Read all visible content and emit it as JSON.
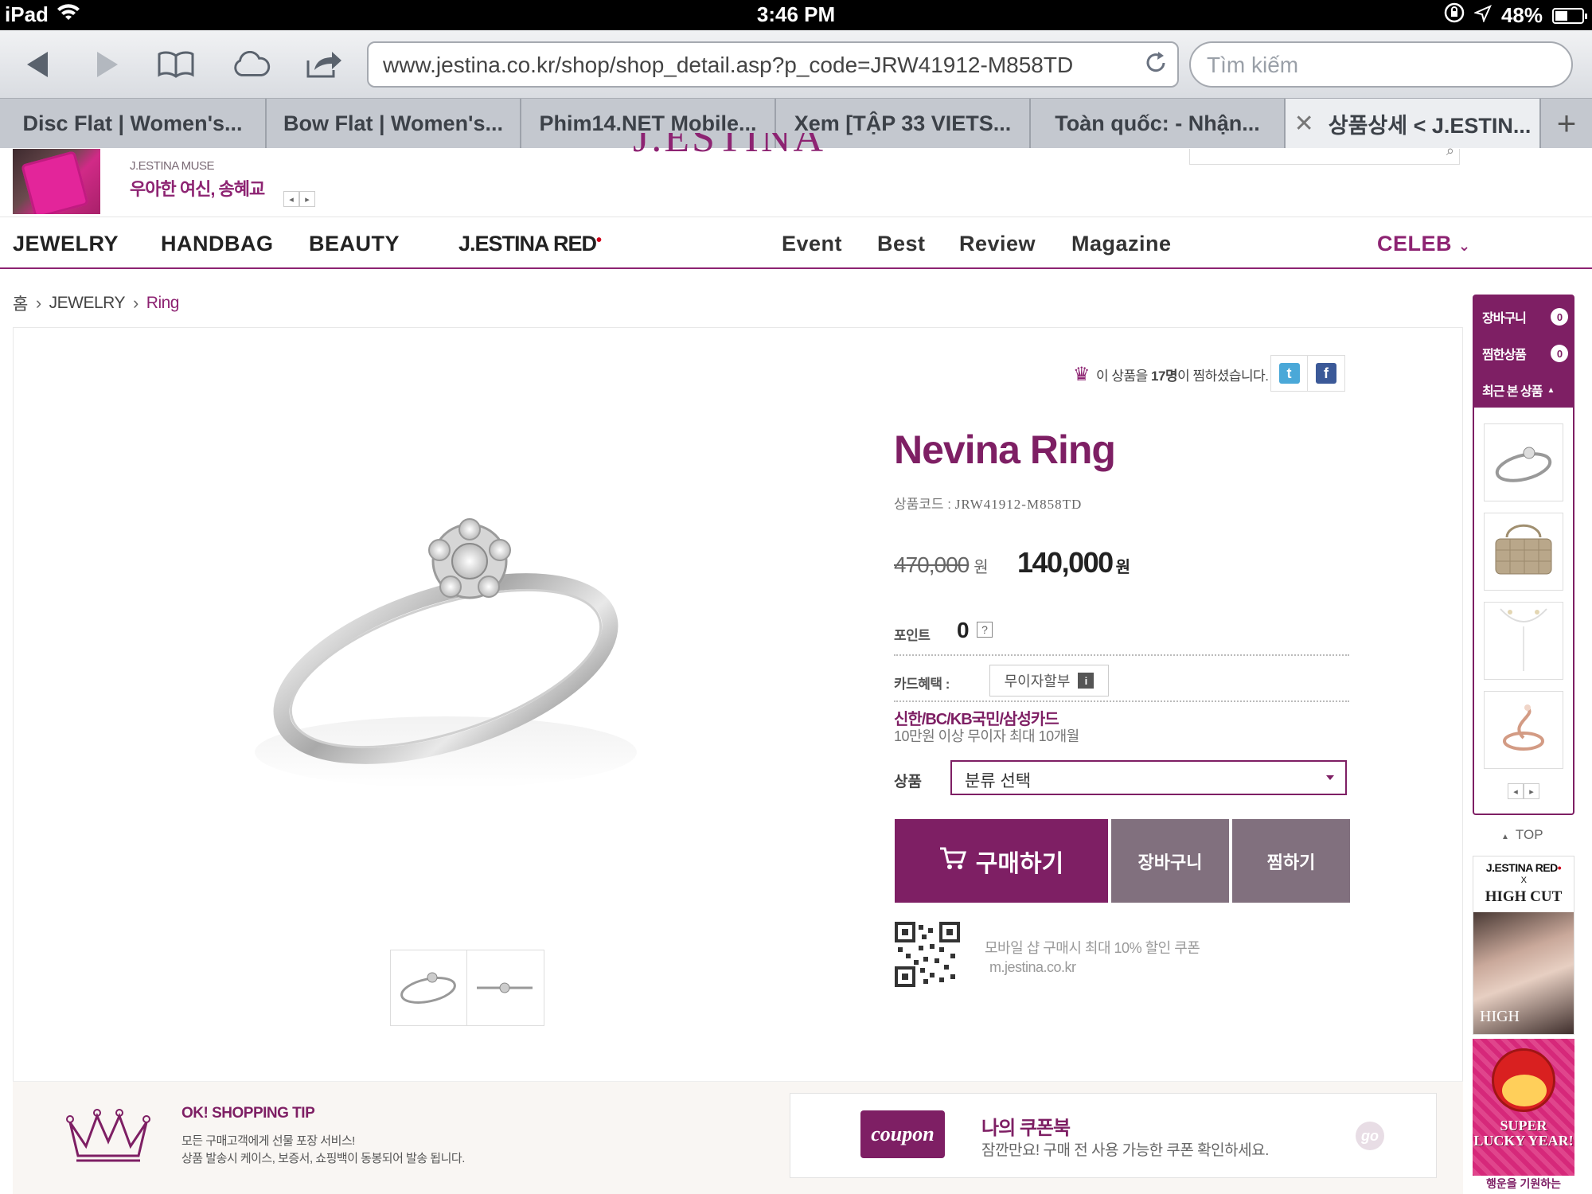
{
  "status_bar": {
    "device": "iPad",
    "time": "3:46 PM",
    "battery": "48%",
    "battery_level": 0.48
  },
  "browser": {
    "url": "www.jestina.co.kr/shop/shop_detail.asp?p_code=JRW41912-M858TD",
    "search_placeholder": "Tìm kiếm",
    "tabs": [
      {
        "label": "Disc Flat | Women's..."
      },
      {
        "label": "Bow Flat | Women's..."
      },
      {
        "label": "Phim14.NET Mobile..."
      },
      {
        "label": "Xem [TẬP 33 VIETS..."
      },
      {
        "label": "Toàn quốc: - Nhận..."
      },
      {
        "label": "상품상세 < J.ESTIN..."
      }
    ],
    "active_tab": 5
  },
  "header": {
    "logo": "J.ESTINA",
    "muse_small": "J.ESTINA MUSE",
    "muse_big": "우아한 여신, 송혜교"
  },
  "nav": {
    "left": [
      "JEWELRY",
      "HANDBAG",
      "BEAUTY",
      "J.ESTINA RED"
    ],
    "middle": [
      "Event",
      "Best",
      "Review",
      "Magazine"
    ],
    "right": "CELEB"
  },
  "breadcrumb": {
    "home": "홈",
    "category": "JEWELRY",
    "current": "Ring"
  },
  "product": {
    "wish_prefix": "이 상품을 ",
    "wish_count": "17명",
    "wish_suffix": "이 찜하셨습니다.",
    "name": "Nevina Ring",
    "code_label": "상품코드 :",
    "code": "JRW41912-M858TD",
    "original_price": "470,000",
    "price": "140,000",
    "currency": "원",
    "points_label": "포인트",
    "points": "0",
    "points_help": "?",
    "card_label": "카드혜택 :",
    "card_button": "무이자할부",
    "card_button_icon": "i",
    "card_names": "신한/BC/KB국민/삼성카드",
    "card_desc": "10만원 이상 무이자 최대 10개월",
    "option_label": "상품",
    "option_selected": "분류 선택",
    "buy_label": "구매하기",
    "cart_label": "장바구니",
    "wish_label": "찜하기",
    "mobile_line1": "모바일 샵 구매시 최대 10% 할인 쿠폰",
    "mobile_line2": "m.jestina.co.kr"
  },
  "tip": {
    "title": "OK! SHOPPING TIP",
    "line1": "모든 구매고객에게 선물 포장 서비스!",
    "line2": "상품 발송시 케이스, 보증서, 쇼핑백이 동봉되어 발송 됩니다."
  },
  "coupon": {
    "badge": "coupon",
    "title": "나의 쿠폰북",
    "desc": "잠깐만요! 구매 전 사용 가능한 쿠폰 확인하세요.",
    "go": "go"
  },
  "quick": {
    "cart": "장바구니",
    "cart_count": "0",
    "wish": "찜한상품",
    "wish_count": "0",
    "recent": "최근 본 상품",
    "top": "TOP"
  },
  "ads": {
    "red_title": "J.ESTINA RED",
    "x": "X",
    "highcut": "HIGH CUT",
    "high": "HIGH",
    "lucky": "SUPER LUCKY YEAR!",
    "lucky_bottom": "행운을 기원하는"
  },
  "colors": {
    "brand": "#7e1f64",
    "button_secondary": "#81707e"
  }
}
